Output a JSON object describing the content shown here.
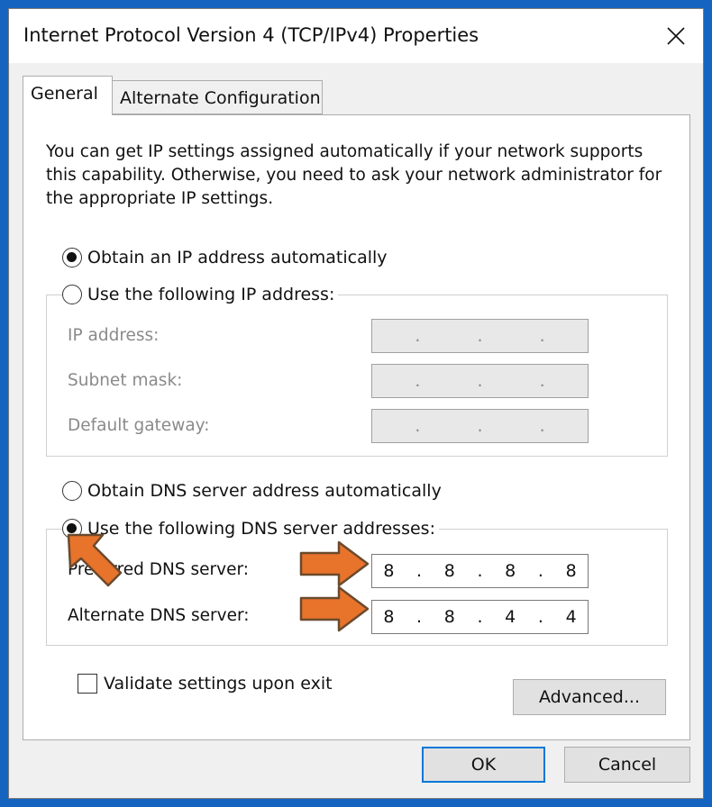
{
  "window": {
    "title": "Internet Protocol Version 4 (TCP/IPv4) Properties"
  },
  "tabs": [
    {
      "label": "General"
    },
    {
      "label": "Alternate Configuration"
    }
  ],
  "intro_text": "You can get IP settings assigned automatically if your network supports this capability. Otherwise, you need to ask your network administrator for the appropriate IP settings.",
  "ip": {
    "auto_label": "Obtain an IP address automatically",
    "manual_label": "Use the following IP address:",
    "fields": [
      {
        "label": "IP address:",
        "octets": [
          "",
          "",
          "",
          ""
        ]
      },
      {
        "label": "Subnet mask:",
        "octets": [
          "",
          "",
          "",
          ""
        ]
      },
      {
        "label": "Default gateway:",
        "octets": [
          "",
          "",
          "",
          ""
        ]
      }
    ]
  },
  "dns": {
    "auto_label": "Obtain DNS server address automatically",
    "manual_label": "Use the following DNS server addresses:",
    "fields": [
      {
        "label": "Preferred DNS server:",
        "octets": [
          "8",
          "8",
          "8",
          "8"
        ]
      },
      {
        "label": "Alternate DNS server:",
        "octets": [
          "8",
          "8",
          "4",
          "4"
        ]
      }
    ]
  },
  "validate_label": "Validate settings upon exit",
  "buttons": {
    "advanced": "Advanced...",
    "ok": "OK",
    "cancel": "Cancel"
  },
  "colors": {
    "frame": "#1565c0",
    "accent": "#0078d7",
    "arrow": "#e8732a"
  }
}
